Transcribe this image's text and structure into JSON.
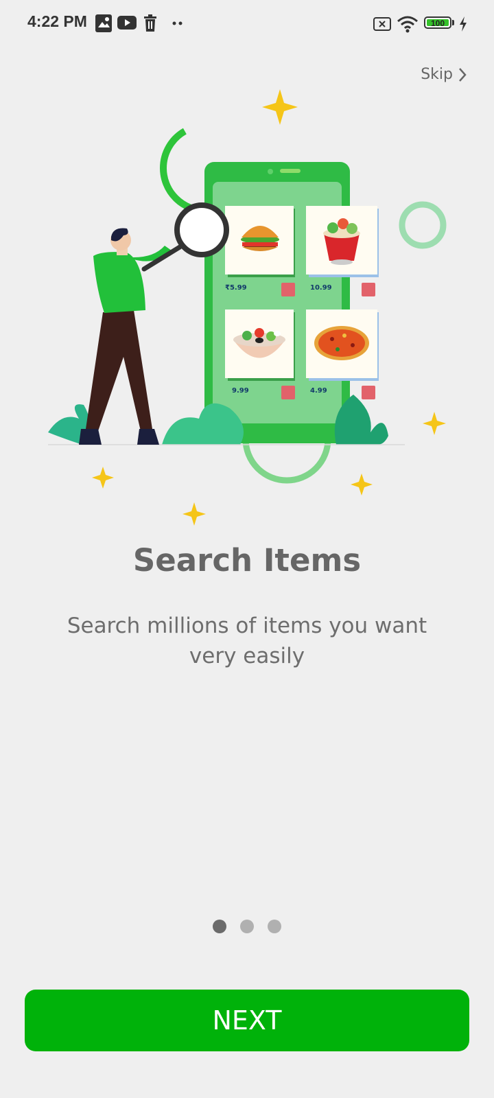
{
  "status_bar": {
    "time": "4:22 PM",
    "left_icons": [
      "gallery-icon",
      "youtube-icon",
      "trash-icon",
      "more-dots-icon"
    ],
    "right_icons": [
      "no-sim-icon",
      "wifi-icon",
      "battery-icon",
      "charging-icon"
    ],
    "battery_level": "100"
  },
  "skip": {
    "label": "Skip"
  },
  "illustration": {
    "products": [
      {
        "price": "₹5.99"
      },
      {
        "price": "10.99"
      },
      {
        "price": "9.99"
      },
      {
        "price": "4.99"
      }
    ]
  },
  "onboarding": {
    "title": "Search Items",
    "description": "Search millions of items you want very easily",
    "page_count": 3,
    "active_page": 1
  },
  "next_button": {
    "label": "NEXT"
  },
  "colors": {
    "primary": "#00b20a",
    "background": "#efefef",
    "text_muted": "#666666",
    "accent_star": "#f5c518"
  }
}
